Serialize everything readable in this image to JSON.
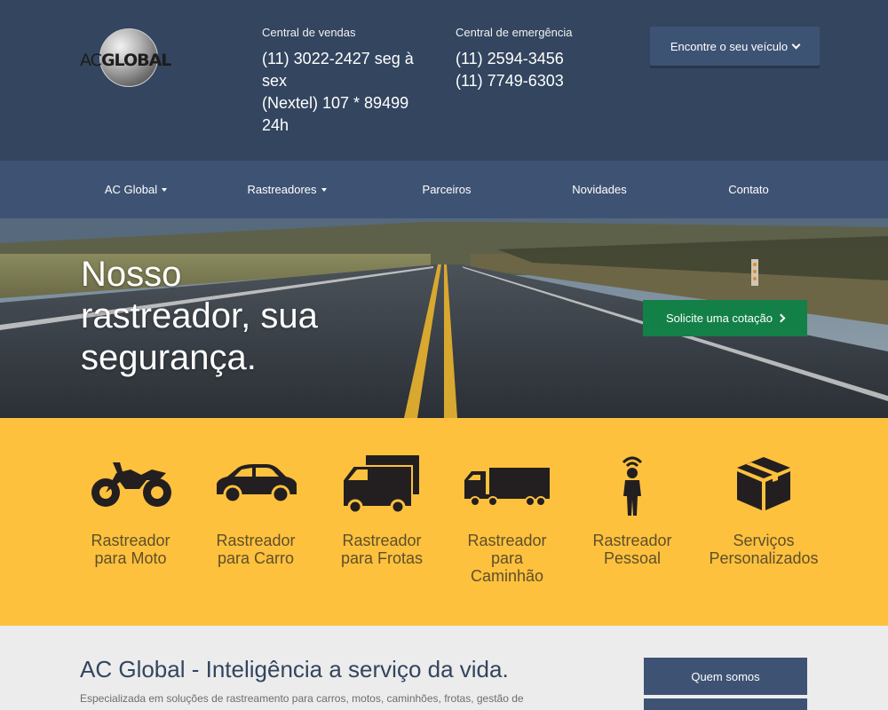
{
  "header": {
    "logo_alt": "AC Global",
    "logo_text_ac": "AC",
    "logo_text_global": "GLOBAL",
    "sales": {
      "label": "Central de vendas",
      "line1": "(11) 3022-2427 seg à",
      "line2": "sex",
      "line3": "(Nextel) 107 * 89499",
      "line4": "24h"
    },
    "emergency": {
      "label": "Central de emergência",
      "line1": "(11) 2594-3456",
      "line2": "(11) 7749-6303"
    },
    "find_vehicle_label": "Encontre o seu veículo"
  },
  "nav": {
    "items": [
      {
        "label": "AC Global",
        "has_caret": true
      },
      {
        "label": "Rastreadores",
        "has_caret": true
      },
      {
        "label": "Parceiros",
        "has_caret": false
      },
      {
        "label": "Novidades",
        "has_caret": false
      },
      {
        "label": "Contato",
        "has_caret": false
      }
    ]
  },
  "hero": {
    "line1": "Nosso",
    "line2": "rastreador, sua",
    "line3": "segurança.",
    "cta_label": "Solicite uma cotação"
  },
  "services": [
    {
      "line1": "Rastreador",
      "line2": "para Moto",
      "line3": "",
      "icon": "motorcycle-icon"
    },
    {
      "line1": "Rastreador",
      "line2": "para Carro",
      "line3": "",
      "icon": "car-icon"
    },
    {
      "line1": "Rastreador",
      "line2": "para Frotas",
      "line3": "",
      "icon": "fleet-vans-icon"
    },
    {
      "line1": "Rastreador",
      "line2": "para",
      "line3": "Caminhão",
      "icon": "truck-icon"
    },
    {
      "line1": "Rastreador",
      "line2": "Pessoal",
      "line3": "",
      "icon": "person-signal-icon"
    },
    {
      "line1": "Serviços",
      "line2": "Personalizados",
      "line3": "",
      "icon": "box-icon"
    }
  ],
  "about": {
    "title": "AC Global - Inteligência a serviço da vida.",
    "text": "Especializada em soluções de rastreamento para carros, motos, caminhões, frotas, gestão de",
    "quem_somos_label": "Quem somos"
  },
  "colors": {
    "header_bg": "#33455f",
    "nav_bg": "#3e5373",
    "cta_green": "#138048",
    "services_yellow": "#fec13d",
    "services_text": "#5e4f2b",
    "icon_dark": "#231f20"
  }
}
